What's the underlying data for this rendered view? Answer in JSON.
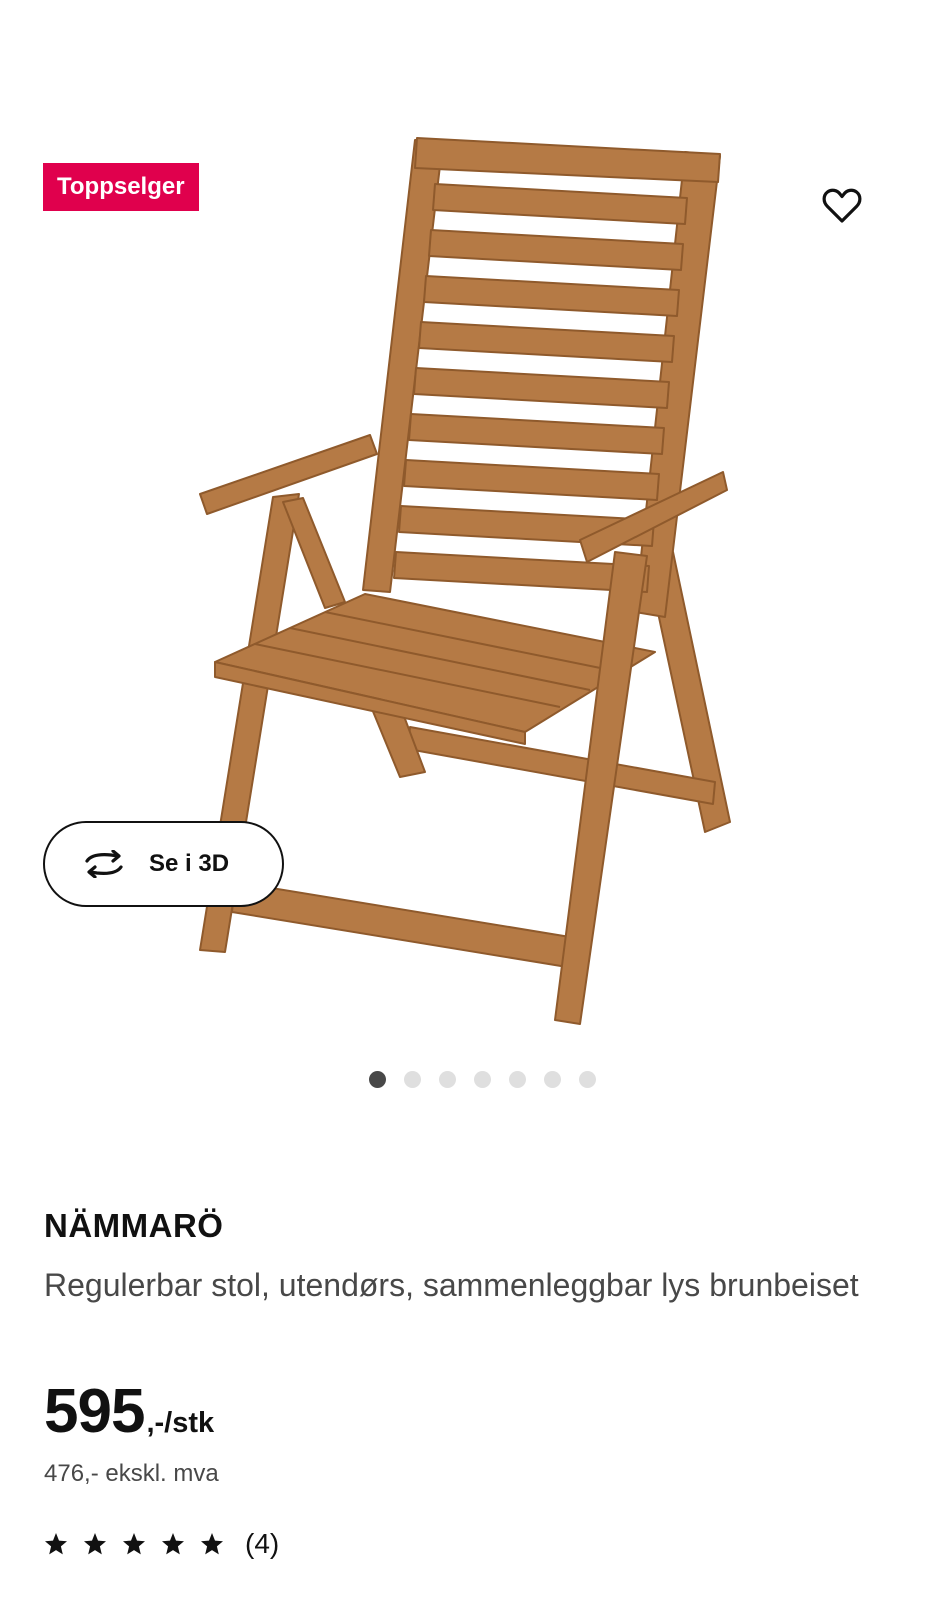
{
  "gallery": {
    "badge": "Toppselger",
    "view_3d_label": "Se i 3D",
    "image_count": 7,
    "active_index": 0
  },
  "product": {
    "name": "NÄMMARÖ",
    "description": "Regulerbar stol, utendørs, sammenleggbar lys brunbeiset",
    "price_main": "595",
    "price_suffix": ",-/stk",
    "price_ex_vat": "476,- ekskl. mva",
    "rating_stars": 5,
    "rating_count": "(4)"
  },
  "icons": {
    "favorite": "heart-outline-icon",
    "view_3d": "rotate-3d-icon",
    "star": "star-icon"
  },
  "colors": {
    "badge_bg": "#e0004d",
    "text": "#111111",
    "secondary_text": "#484848",
    "wood": "#b57a45"
  }
}
